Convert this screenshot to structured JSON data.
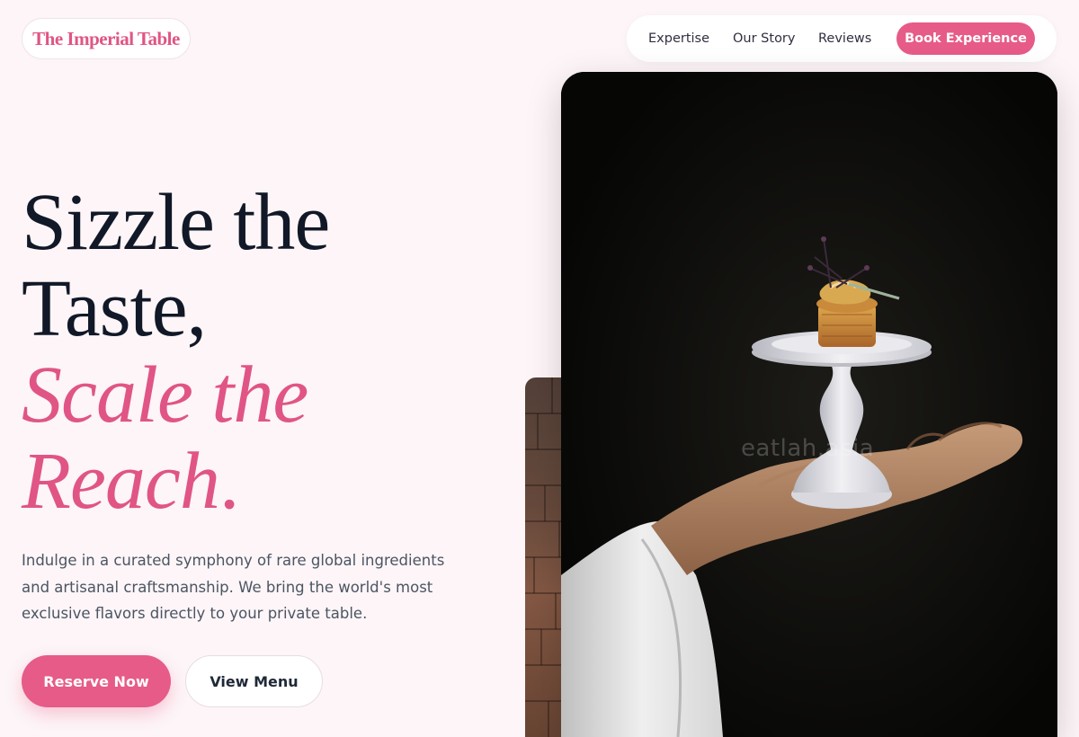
{
  "brand": {
    "name": "The Imperial Table"
  },
  "nav": {
    "links": [
      "Expertise",
      "Our Story",
      "Reviews"
    ],
    "cta_label": "Book Experience"
  },
  "hero": {
    "headline": {
      "line1": "Sizzle the",
      "line2": "Taste,",
      "line3": "Scale the",
      "line4_word": "Reach",
      "line4_dot": "."
    },
    "description": "Indulge in a curated symphony of rare global ingredients and artisanal craftsmanship. We bring the world's most exclusive flavors directly to your private table.",
    "primary_button": "Reserve Now",
    "secondary_button": "View Menu"
  },
  "image": {
    "subject": "hand-holding-dessert-stand",
    "watermark": "eatlah.asia"
  },
  "colors": {
    "accent": "#e75b88",
    "heading": "#111827",
    "body_text": "#4b5563",
    "page_background": "#fdf5f7"
  }
}
